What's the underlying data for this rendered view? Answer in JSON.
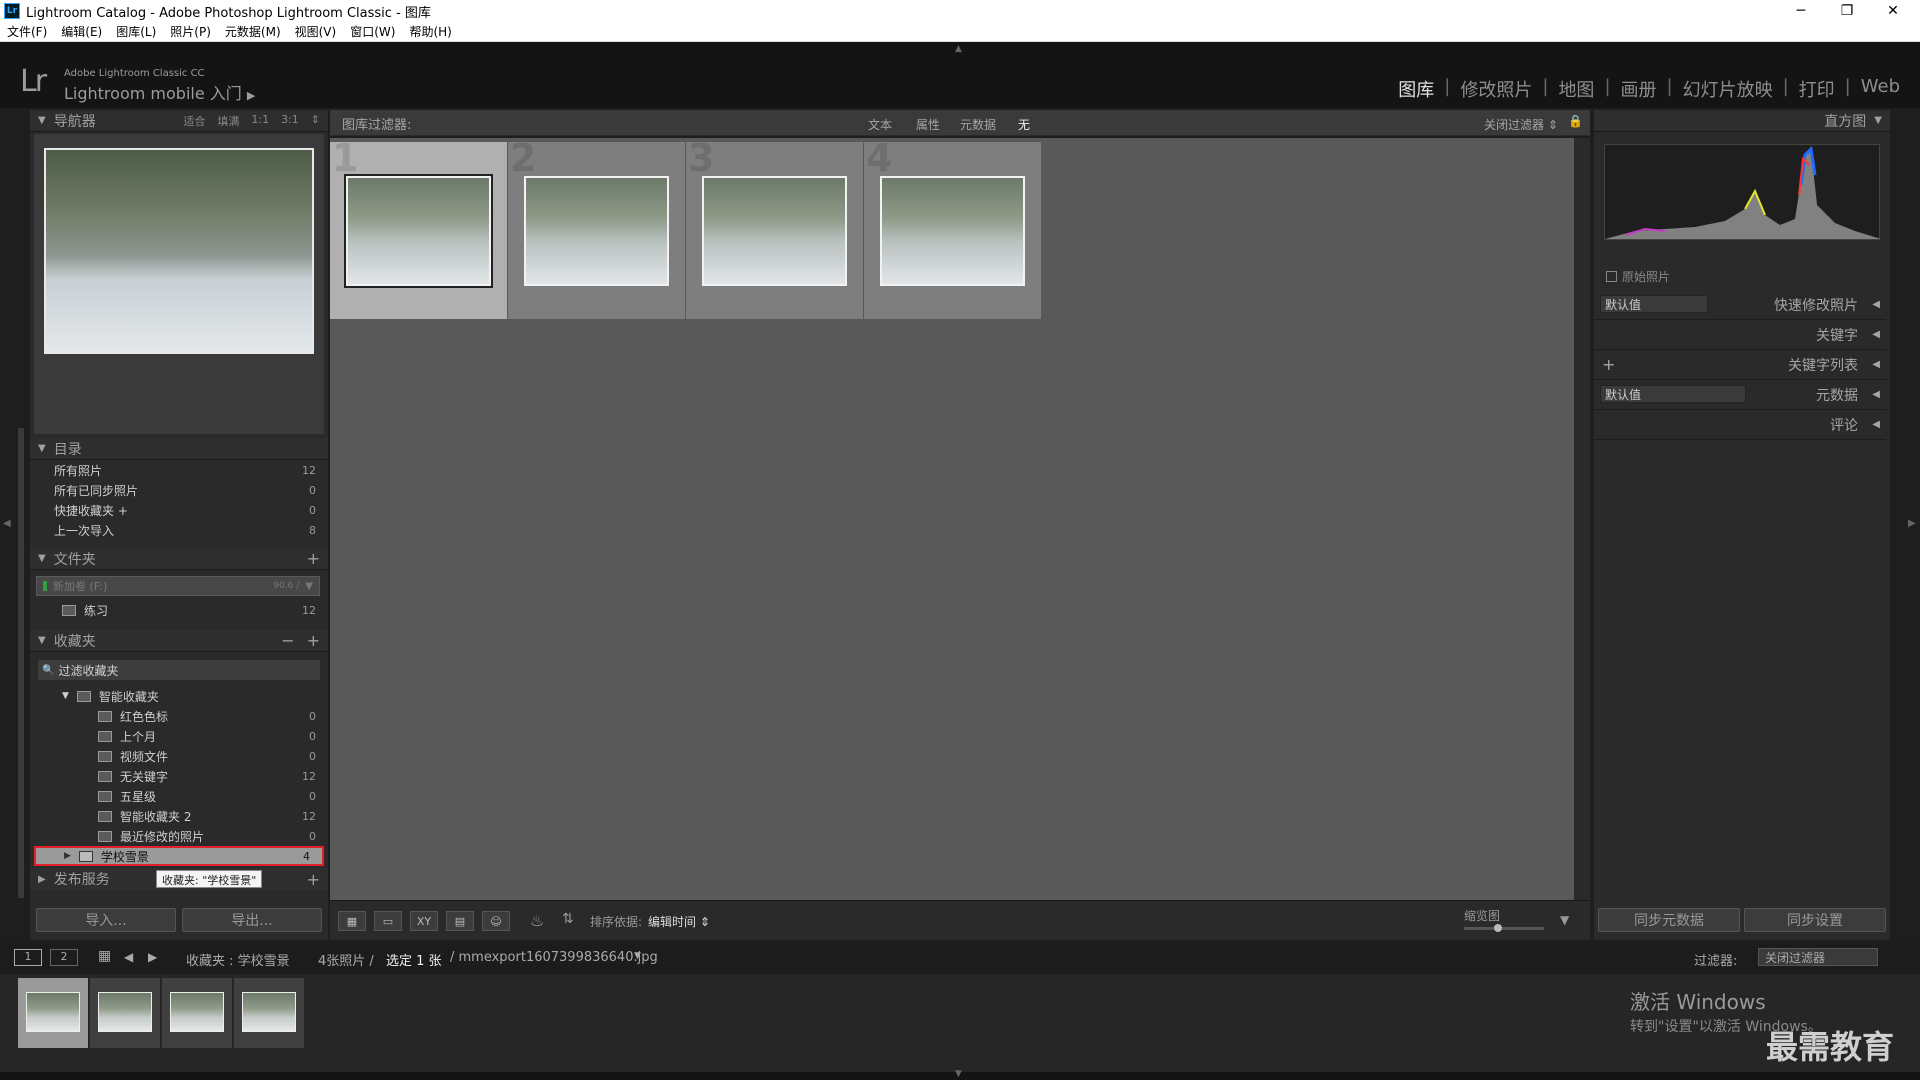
{
  "window": {
    "title": "Lightroom Catalog - Adobe Photoshop Lightroom Classic - 图库",
    "app_icon": "Lr",
    "minimize": "─",
    "maximize": "❐",
    "close": "✕"
  },
  "menu": [
    "文件(F)",
    "编辑(E)",
    "图库(L)",
    "照片(P)",
    "元数据(M)",
    "视图(V)",
    "窗口(W)",
    "帮助(H)"
  ],
  "identity": {
    "logo": "Lr",
    "small": "Adobe Lightroom Classic CC",
    "big": "Lightroom mobile 入门",
    "arrow": "▶"
  },
  "modules": [
    "图库",
    "修改照片",
    "地图",
    "画册",
    "幻灯片放映",
    "打印",
    "Web"
  ],
  "module_separator": "|",
  "navigator": {
    "title": "导航器",
    "zoom_options": [
      "适合",
      "填满",
      "1:1",
      "3:1"
    ],
    "zoom_arrow": "⇕"
  },
  "catalog": {
    "title": "目录",
    "items": [
      {
        "label": "所有照片",
        "count": "12"
      },
      {
        "label": "所有已同步照片",
        "count": "0"
      },
      {
        "label": "快捷收藏夹 +",
        "count": "0"
      },
      {
        "label": "上一次导入",
        "count": "8"
      }
    ]
  },
  "folders": {
    "title": "文件夹",
    "plus": "+",
    "volume_name": "新加卷 (F:)",
    "volume_stat": "90.6 / ",
    "volume_arrow": "▼",
    "items": [
      {
        "label": "练习",
        "count": "12"
      }
    ]
  },
  "collections": {
    "title": "收藏夹",
    "minus": "−",
    "plus": "+",
    "filter_placeholder": "过滤收藏夹",
    "search_icon": "🔍",
    "smart_set": "智能收藏夹",
    "items": [
      {
        "label": "红色色标",
        "count": "0"
      },
      {
        "label": "上个月",
        "count": "0"
      },
      {
        "label": "视频文件",
        "count": "0"
      },
      {
        "label": "无关键字",
        "count": "12"
      },
      {
        "label": "五星级",
        "count": "0"
      },
      {
        "label": "智能收藏夹 2",
        "count": "12"
      },
      {
        "label": "最近修改的照片",
        "count": "0"
      }
    ],
    "selected": {
      "label": "学校雪景",
      "count": "4"
    },
    "tooltip": "收藏夹: \"学校雪景\""
  },
  "publish": {
    "title": "发布服务",
    "plus": "+"
  },
  "left_buttons": {
    "import": "导入...",
    "export": "导出..."
  },
  "filter_bar": {
    "title": "图库过滤器:",
    "tabs": [
      "文本",
      "属性",
      "元数据",
      "无"
    ],
    "active_tab": "无",
    "preset": "关闭过滤器 ⇕",
    "lock_icon": "🔒"
  },
  "grid": {
    "cells": [
      {
        "index": "1",
        "selected": true
      },
      {
        "index": "2",
        "selected": false
      },
      {
        "index": "3",
        "selected": false
      },
      {
        "index": "4",
        "selected": false
      }
    ]
  },
  "toolbar": {
    "sort_label": "排序依据:",
    "sort_value": "编辑时间 ⇕",
    "thumb_label": "缩览图",
    "grid_icon": "▦",
    "loupe_icon": "▭",
    "compare_icon": "XY",
    "survey_icon": "▤",
    "people_icon": "☺",
    "spray_icon": "♨",
    "sort_icon": "⇅",
    "dropdown": "▼"
  },
  "right_panel": {
    "histogram_title": "直方图",
    "original_photo": "原始照片",
    "quick_develop": "快速修改照片",
    "keywords": "关键字",
    "keyword_list": "关键字列表",
    "metadata": "元数据",
    "comments": "评论",
    "default_preset": "默认值",
    "plus": "+",
    "arrow": "◀",
    "buttons": {
      "sync_metadata": "同步元数据",
      "sync_settings": "同步设置"
    }
  },
  "filmstrip_bar": {
    "view1": "1",
    "view2": "2",
    "grid_icon": "▦",
    "back_icon": "◀",
    "forward_icon": "▶",
    "source": "收藏夹 : 学校雪景",
    "count": "4张照片 /",
    "selected": "选定 1 张",
    "file": "/ mmexport1607399836640.jpg",
    "file_arrow": "▼",
    "filter_label": "过滤器:",
    "filter_value": "关闭过滤器"
  },
  "watermark": {
    "activate_title": "激活 Windows",
    "activate_sub": "转到\"设置\"以激活 Windows。",
    "brand": "最需教育"
  },
  "edge_arrows": {
    "up": "▲",
    "down": "▼",
    "left": "◀",
    "right": "▶"
  }
}
